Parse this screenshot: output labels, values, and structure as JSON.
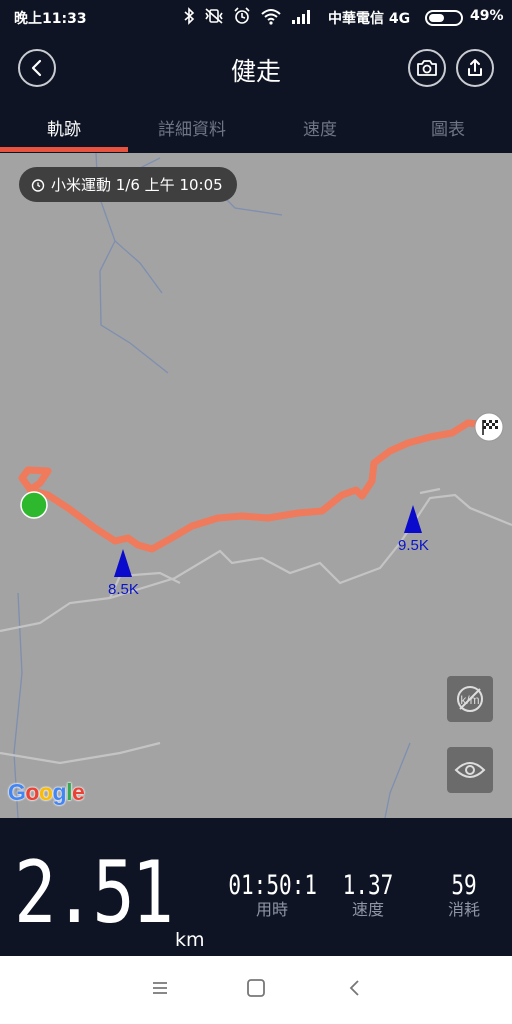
{
  "status_bar": {
    "time": "晚上11:33",
    "carrier": "中華電信 4G",
    "battery": "49%",
    "battery_level": 0.49
  },
  "header": {
    "title": "健走"
  },
  "tabs": [
    {
      "label": "軌跡",
      "active": true
    },
    {
      "label": "詳細資料",
      "active": false
    },
    {
      "label": "速度",
      "active": false
    },
    {
      "label": "圖表",
      "active": false
    }
  ],
  "map": {
    "source_label": "小米運動 1/6 上午 10:05",
    "km_markers": [
      "8.5K",
      "9.5K"
    ],
    "attribution": "Google",
    "route_color": "#f07a5c",
    "start_color": "#2db82d",
    "marker_color": "#0a0acc"
  },
  "stats": {
    "distance": "2.51",
    "distance_unit": "km",
    "items": [
      {
        "value": "01:50:1",
        "label": "用時"
      },
      {
        "value": "1.37",
        "label": "速度"
      },
      {
        "value": "59",
        "label": "消耗"
      }
    ]
  },
  "icons": [
    "bluetooth-icon",
    "vibrate-off-icon",
    "alarm-icon",
    "wifi-icon",
    "signal-icon",
    "back-icon",
    "camera-icon",
    "share-icon",
    "stopwatch-icon",
    "finish-flag-icon",
    "km-toggle-icon",
    "eye-icon",
    "menu-icon",
    "home-icon",
    "nav-back-icon"
  ]
}
